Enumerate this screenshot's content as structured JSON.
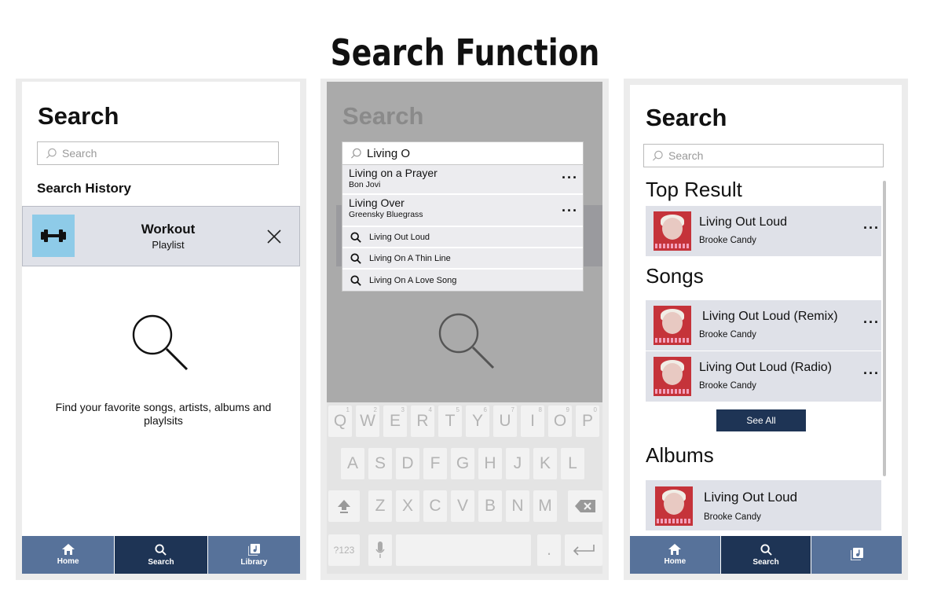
{
  "page_title": "Search Function",
  "screen1": {
    "title": "Search",
    "search_placeholder": "Search",
    "history_label": "Search History",
    "history_item": {
      "title": "Workout",
      "subtitle": "Playlist"
    },
    "empty_text": "Find your favorite songs, artists, albums and playlsits",
    "nav": [
      {
        "label": "Home",
        "icon": "home-icon"
      },
      {
        "label": "Search",
        "icon": "search-icon",
        "active": true
      },
      {
        "label": "Library",
        "icon": "library-icon"
      }
    ]
  },
  "screen2": {
    "title": "Search",
    "query": "Living O",
    "songs": [
      {
        "title": "Living on a Prayer",
        "artist": "Bon Jovi"
      },
      {
        "title": "Living Over",
        "artist": "Greensky Bluegrass"
      }
    ],
    "suggestions": [
      "Living Out Loud",
      "Living On A Thin Line",
      "Living On A Love Song"
    ],
    "keyboard": {
      "row1": [
        "Q",
        "W",
        "E",
        "R",
        "T",
        "Y",
        "U",
        "I",
        "O",
        "P"
      ],
      "row1_nums": [
        "1",
        "2",
        "3",
        "4",
        "5",
        "6",
        "7",
        "8",
        "9",
        "0"
      ],
      "row2": [
        "A",
        "S",
        "D",
        "F",
        "G",
        "H",
        "J",
        "K",
        "L"
      ],
      "row3": [
        "Z",
        "X",
        "C",
        "V",
        "B",
        "N",
        "M"
      ],
      "mode_key": "?123",
      "period_key": "."
    }
  },
  "screen3": {
    "title": "Search",
    "search_placeholder": "Search",
    "top_result_label": "Top Result",
    "top_result": {
      "title": "Living Out Loud",
      "artist": "Brooke Candy"
    },
    "songs_label": "Songs",
    "songs": [
      {
        "title": "Living Out Loud (Remix)",
        "artist": "Brooke Candy"
      },
      {
        "title": "Living Out Loud (Radio)",
        "artist": "Brooke Candy"
      }
    ],
    "see_all": "See All",
    "albums_label": "Albums",
    "album": {
      "title": "Living Out Loud",
      "artist": "Brooke Candy"
    },
    "nav": [
      {
        "label": "Home",
        "icon": "home-icon"
      },
      {
        "label": "Search",
        "icon": "search-icon",
        "active": true
      },
      {
        "label": "",
        "icon": "library-icon"
      }
    ]
  },
  "colors": {
    "nav": "#57729a",
    "nav_active": "#1e3455",
    "row_bg": "#dfe1e8",
    "playlist_thumb": "#8ecbe8",
    "album_art": "#c5333a"
  }
}
